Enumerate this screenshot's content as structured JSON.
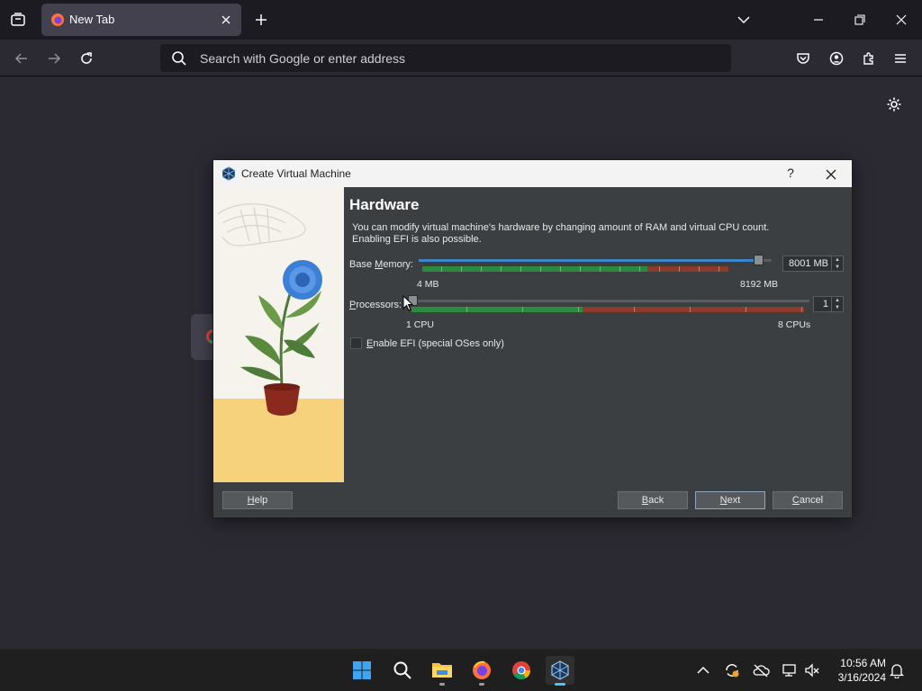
{
  "browser": {
    "tab": {
      "title": "New Tab"
    },
    "urlbar": {
      "placeholder": "Search with Google or enter address"
    }
  },
  "dialog": {
    "title": "Create Virtual Machine",
    "help_glyph": "?",
    "heading": "Hardware",
    "description_line1": "You can modify virtual machine's hardware by changing amount of RAM and virtual CPU count.",
    "description_line2": "Enabling EFI is also possible.",
    "base_memory": {
      "label_prefix": "Base ",
      "label_mnemonic": "M",
      "label_suffix": "emory:",
      "value": "8001 MB",
      "min_label": "4 MB",
      "max_label": "8192 MB",
      "fraction": 0.977
    },
    "processors": {
      "label_mnemonic": "P",
      "label_suffix": "rocessors:",
      "value": "1",
      "min_label": "1 CPU",
      "max_label": "8 CPUs",
      "fraction": 0.0
    },
    "efi": {
      "label_mnemonic": "E",
      "label_suffix": "nable EFI (special OSes only)",
      "checked": false
    },
    "buttons": {
      "help_mnemonic": "H",
      "help_suffix": "elp",
      "back_mnemonic": "B",
      "back_suffix": "ack",
      "next_mnemonic": "N",
      "next_suffix": "ext",
      "cancel_mnemonic": "C",
      "cancel_suffix": "ancel"
    }
  },
  "taskbar": {
    "clock_time": "10:56 AM",
    "clock_date": "3/16/2024"
  },
  "colors": {
    "accent": "#4cc2ff",
    "slider_fill": "#3a86c8",
    "zone_green": "#2b8a3e",
    "zone_red": "#8c3b2a"
  }
}
